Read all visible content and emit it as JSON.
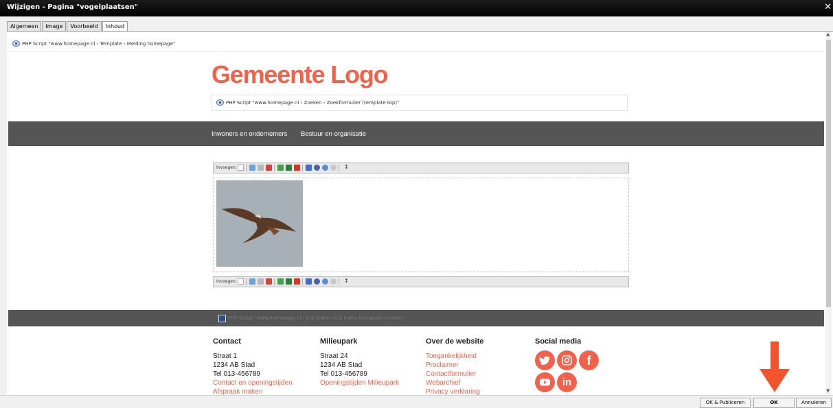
{
  "window": {
    "title": "Wijzigen - Pagina \"vogelplaatsen\"",
    "close": "✕"
  },
  "tabs": [
    "Algemeen",
    "Image",
    "Voorbeeld",
    "Inhoud"
  ],
  "breadcrumb_top": "PHP Script \"www.homepage.nl › Template › Melding homepage\"",
  "logo": "Gemeente Logo",
  "breadcrumb_search": "PHP Script \"www.homepage.nl ›  Zoeken › Zoekformulier (template top)\"",
  "nav": {
    "item1": "Inwoners en ondernemers",
    "item2": "Bestuur en organisatie"
  },
  "toolbar": {
    "label": "Invoegen:",
    "cursor": "↕"
  },
  "footer_crumb": "PHP Script \"www.homepage.nl › A-Z Index › A-Z Index (template include)\"",
  "footer": {
    "contact": {
      "title": "Contact",
      "l1": "Straat 1",
      "l2": "1234 AB  Stad",
      "l3": "Tel 013-456789",
      "link1": "Contact en openingstijden",
      "link2": "Afspraak maken"
    },
    "milieupark": {
      "title": "Milieupark",
      "l1": "Straat 24",
      "l2": "1234 AB  Stad",
      "l3": "Tel 013-456789",
      "link1": "Openingstijden Milieupark"
    },
    "website": {
      "title": "Over de website",
      "link1": "Toegankelijkheid",
      "link2": "Proclaimer",
      "link3": "Contactformulier",
      "link4": "Webarchief",
      "link5": "Privacy verklaring"
    },
    "social": {
      "title": "Social media",
      "icons": [
        "twitter-icon",
        "instagram-icon",
        "facebook-icon",
        "youtube-icon",
        "linkedin-icon"
      ],
      "facebook": "f",
      "linkedin": "in"
    }
  },
  "buttons": {
    "ok_publish": "OK & Publiceren",
    "ok": "OK",
    "cancel": "Annuleren"
  },
  "colors": {
    "accent": "#f2624a",
    "nav": "#555555",
    "arrow": "#f2542e"
  }
}
